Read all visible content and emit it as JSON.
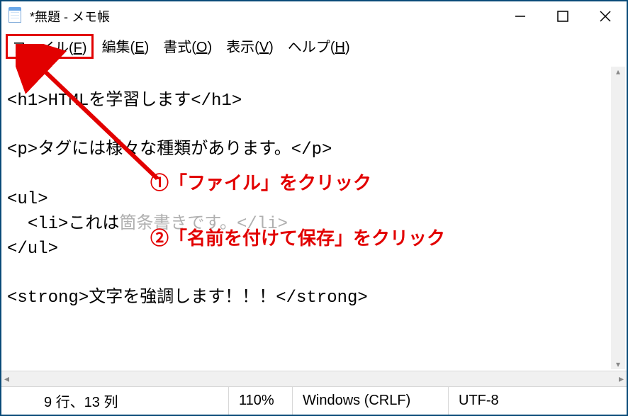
{
  "window": {
    "title": "*無題 - メモ帳"
  },
  "menu": {
    "file": "ファイル(",
    "file_key": "F",
    "file_close": ")",
    "edit": "編集(",
    "edit_key": "E",
    "edit_close": ")",
    "format": "書式(",
    "format_key": "O",
    "format_close": ")",
    "view": "表示(",
    "view_key": "V",
    "view_close": ")",
    "help": "ヘルプ(",
    "help_key": "H",
    "help_close": ")"
  },
  "editor": {
    "line1": "<h1>HTMLを学習します</h1>",
    "blank": "",
    "line2": "<p>タグには様々な種類があります。</p>",
    "line3": "<ul>",
    "line4_a": "  <li>これは",
    "line4_b": "箇条書きです。</li>",
    "line5": "</ul>",
    "line6": "<strong>文字を強調します！！！</strong>"
  },
  "annotations": {
    "step1": "①「ファイル」をクリック",
    "step2": "②「名前を付けて保存」をクリック"
  },
  "status": {
    "position": "9 行、13 列",
    "zoom": "110%",
    "eol": "Windows (CRLF)",
    "encoding": "UTF-8"
  }
}
